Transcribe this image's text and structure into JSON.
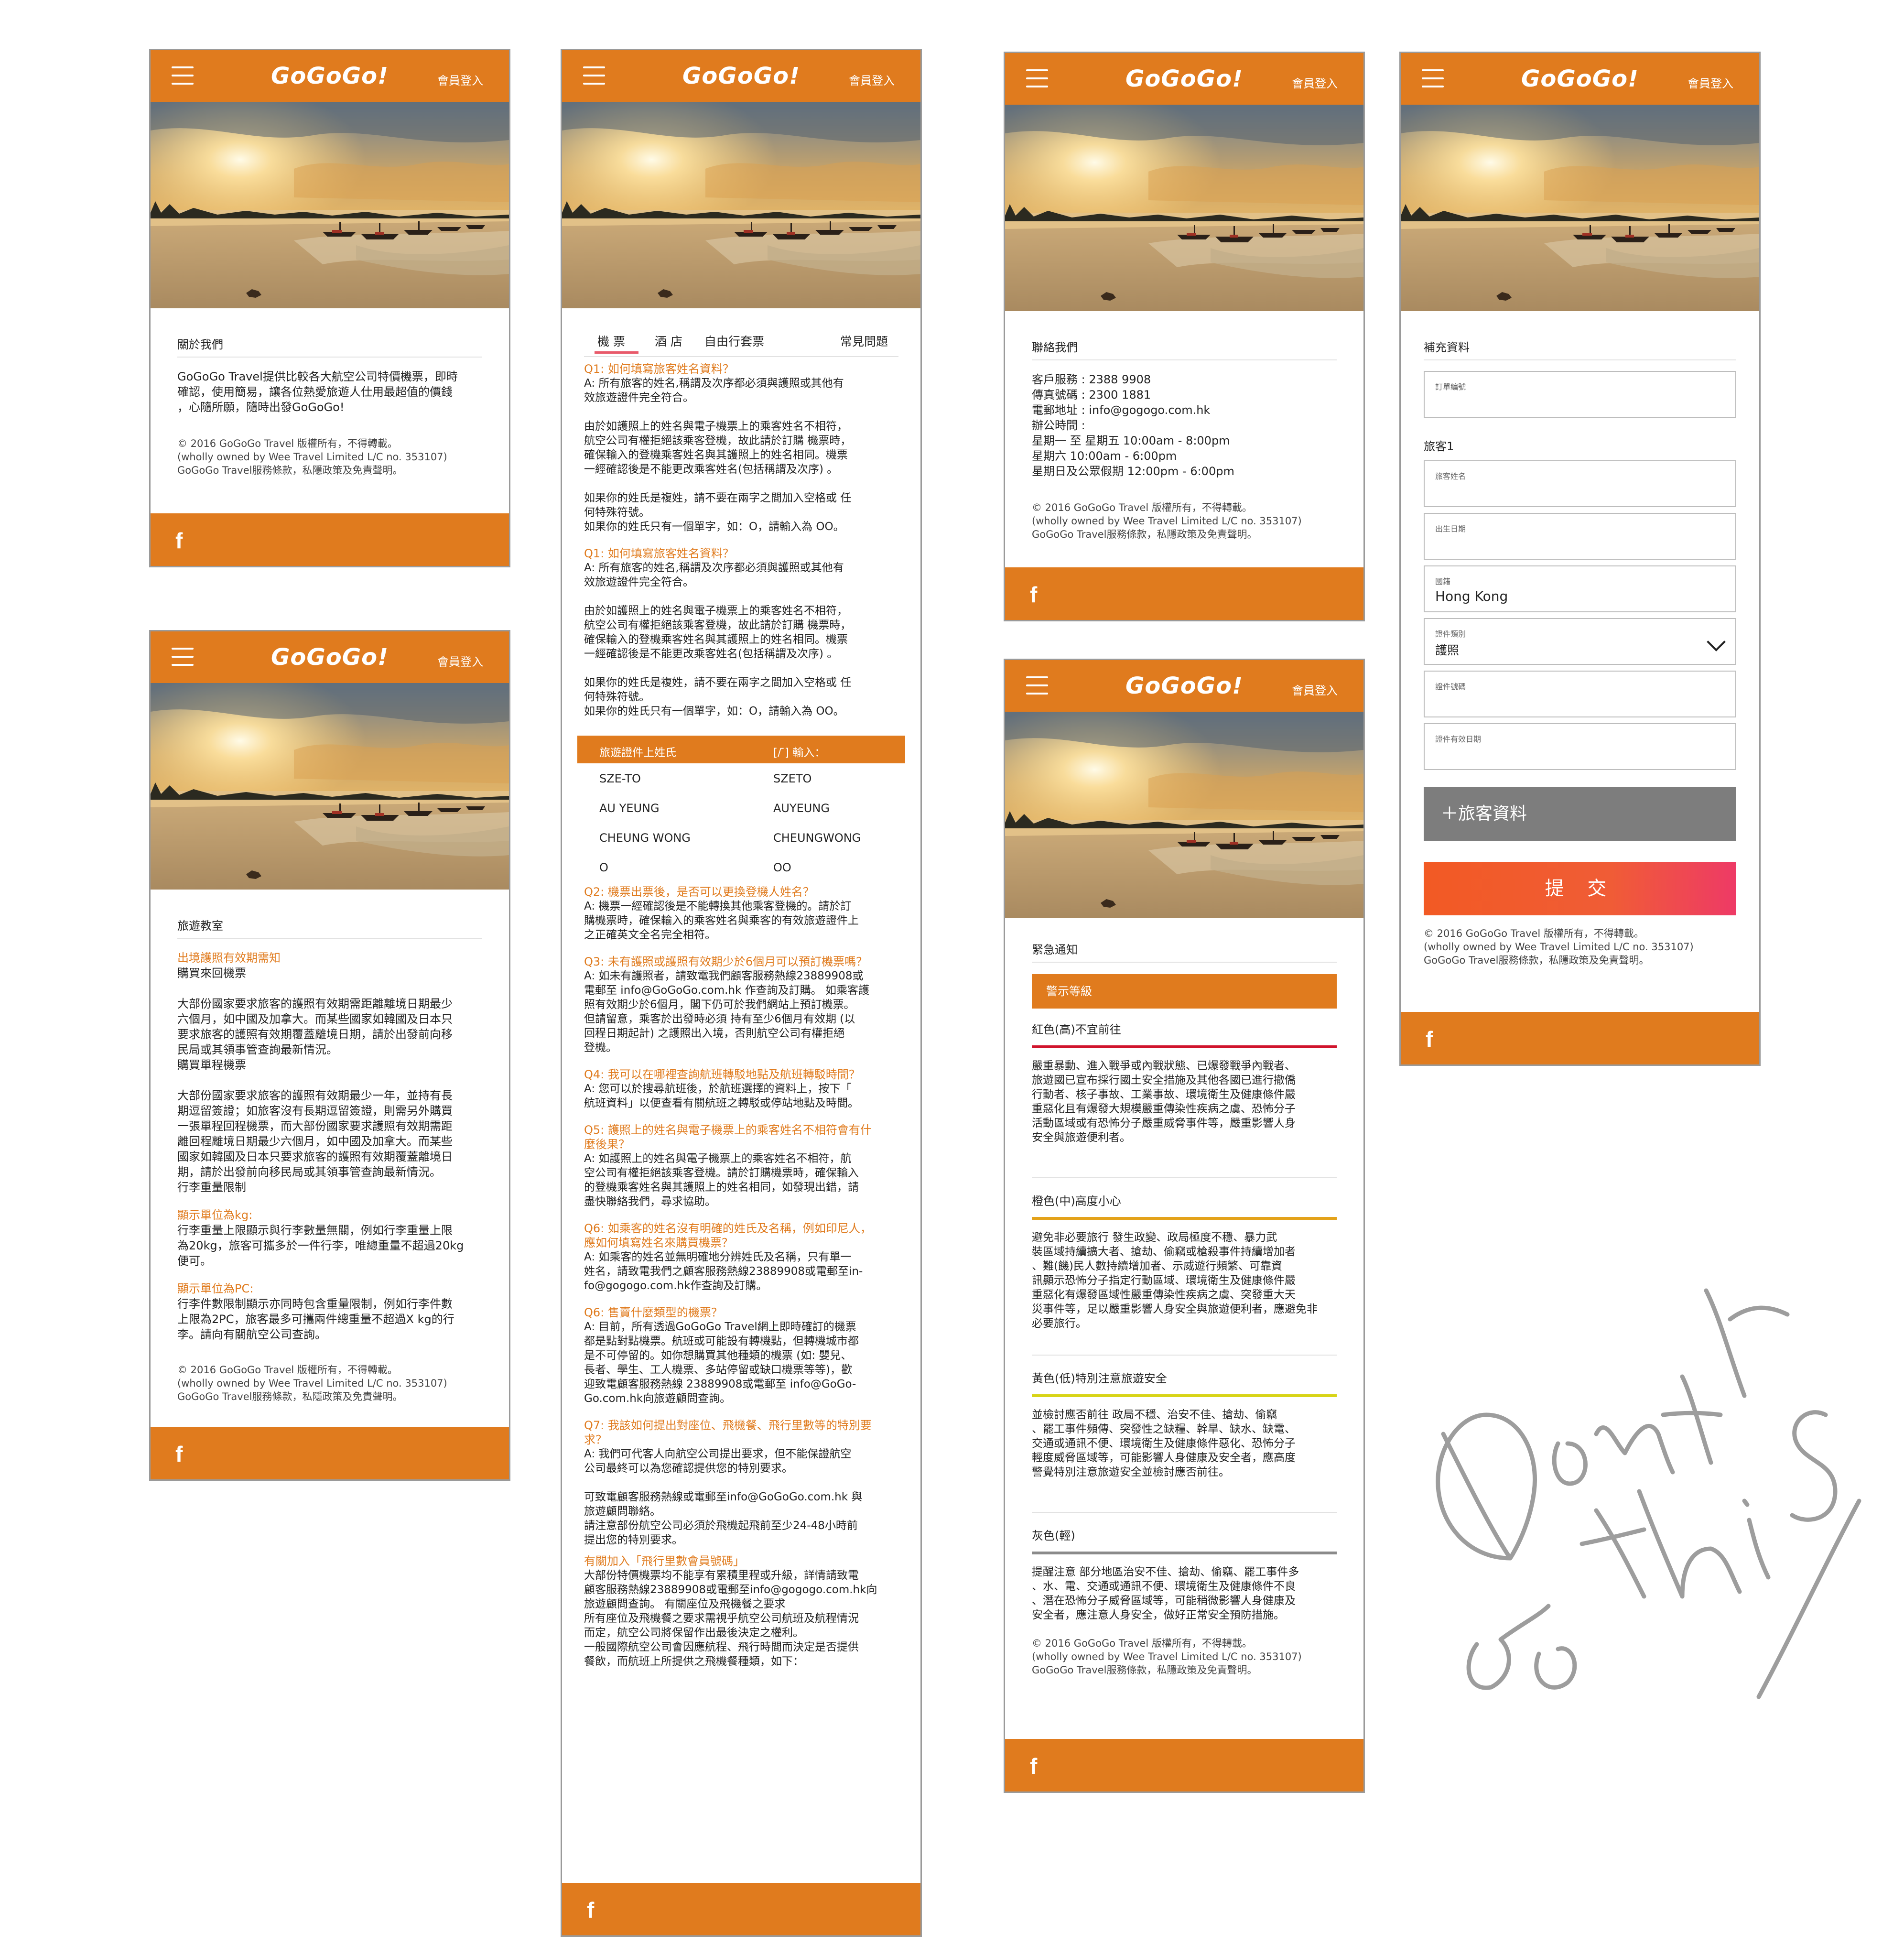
{
  "brand": {
    "logo": "GoGoGo!",
    "login": "會員登入",
    "orange": "#e07b1e"
  },
  "copyright": {
    "line1": "© 2016 GoGoGo Travel 版權所有，不得轉載。",
    "line2": "(wholly owned by Wee Travel Limited L/C no. 353107)",
    "line3": "GoGoGo Travel服務條款，私隱政策及免責聲明。"
  },
  "about": {
    "title": "關於我們",
    "body": "GoGoGo Travel提供比較各大航空公司特價機票，即時\n確認，使用簡易，讓各位熱愛旅遊人仕用最超值的價錢\n，心隨所願，隨時出發GoGoGo!"
  },
  "classroom": {
    "title": "旅遊教室",
    "h1": "出境護照有效期需知",
    "p1": "購買來回機票\n\n大部份國家要求旅客的護照有效期需距離離境日期最少\n六個月，如中國及加拿大。而某些國家如韓國及日本只\n要求旅客的護照有效期覆蓋離境日期，請於出發前向移\n民局或其領事管查詢最新情況。\n購買單程機票\n\n大部份國家要求旅客的護照有效期最少一年，並持有長\n期逗留簽證；如旅客沒有長期逗留簽證，則需另外購買\n一張單程回程機票，而大部份國家要求護照有效期需距\n離回程離境日期最少六個月，如中國及加拿大。而某些\n國家如韓國及日本只要求旅客的護照有效期覆蓋離境日\n期，請於出發前向移民局或其領事管查詢最新情況。\n行李重量限制",
    "h2": "顯示單位為kg:",
    "p2": "行李重量上限顯示與行李數量無關，例如行李重量上限\n為20kg，旅客可攜多於一件行李，唯總重量不超過20kg\n便可。",
    "h3": "顯示單位為PC:",
    "p3": "行李件數限制顯示亦同時包含重量限制，例如行李件數\n上限為2PC，旅客最多可攜兩件總重量不超過X kg的行\n李。請向有關航空公司查詢。"
  },
  "faq": {
    "tabs": [
      "機 票",
      "酒 店",
      "自由行套票",
      "常見問題"
    ],
    "q1": "Q1: 如何填寫旅客姓名資料？",
    "a1": "A: 所有旅客的姓名,稱謂及次序都必須與護照或其他有\n效旅遊證件完全符合。\n\n由於如護照上的姓名與電子機票上的乘客姓名不相符，\n航空公司有權拒絕該乘客登機，故此請於訂購 機票時，\n確保輸入的登機乘客姓名與其護照上的姓名相同。機票\n一經確認後是不能更改乘客姓名(包括稱謂及次序) 。\n\n如果你的姓氏是複姓，請不要在兩字之間加入空格或 任\n何特殊符號。\n如果你的姓氏只有一個單字，如：O，請輸入為 OO。",
    "q1b": "Q1: 如何填寫旅客姓名資料？",
    "a1b": "A: 所有旅客的姓名,稱謂及次序都必須與護照或其他有\n效旅遊證件完全符合。\n\n由於如護照上的姓名與電子機票上的乘客姓名不相符，\n航空公司有權拒絕該乘客登機，故此請於訂購 機票時，\n確保輸入的登機乘客姓名與其護照上的姓名相同。機票\n一經確認後是不能更改乘客姓名(包括稱謂及次序) 。\n\n如果你的姓氏是複姓，請不要在兩字之間加入空格或 任\n何特殊符號。\n如果你的姓氏只有一個單字，如：O，請輸入為 OO。",
    "table": {
      "head": [
        "旅遊證件上姓氏",
        "[/ ̄] 輸入："
      ],
      "rows": [
        [
          "SZE-TO",
          "SZETO"
        ],
        [
          "AU YEUNG",
          "AUYEUNG"
        ],
        [
          "CHEUNG WONG",
          "CHEUNGWONG"
        ],
        [
          "O",
          "OO"
        ]
      ]
    },
    "q2": "Q2: 機票出票後，是否可以更換登機人姓名？",
    "a2": "A: 機票一經確認後是不能轉換其他乘客登機的。請於訂\n購機票時，確保輸入的乘客姓名與乘客的有效旅遊證件上\n之正確英文全名完全相符。",
    "q3": "Q3: 未有護照或護照有效期少於6個月可以預訂機票嗎？",
    "a3": "A: 如未有護照者，請致電我們顧客服務熱線23889908或\n電郵至 info@GoGoGo.com.hk 作查詢及訂購。 如乘客護\n照有效期少於6個月，閣下仍可於我們網站上預訂機票。\n但請留意，乘客於出發時必須 持有至少6個月有效期 (以\n回程日期起計) 之護照出入境，否則航空公司有權拒絕\n登機。",
    "q4": "Q4: 我可以在哪裡查詢航班轉駁地點及航班轉駁時間？",
    "a4": "A: 您可以於搜尋航班後，於航班選擇的資料上，按下「\n航班資料」以便查看有關航班之轉駁或停站地點及時間。",
    "q5": "Q5: 護照上的姓名與電子機票上的乘客姓名不相符會有什\n麼後果？",
    "a5": "A: 如護照上的姓名與電子機票上的乘客姓名不相符，航\n空公司有權拒絕該乘客登機。請於訂購機票時，確保輸入\n的登機乘客姓名與其護照上的姓名相同，如發現出錯，請\n盡快聯絡我們，尋求協助。",
    "q6": "Q6: 如乘客的姓名沒有明確的姓氏及名稱，例如印尼人，\n應如何填寫姓名來購買機票？",
    "a6": "A: 如乘客的姓名並無明確地分辨姓氏及名稱，只有單一\n姓名，請致電我們之顧客服務熱線23889908或電郵至in-\nfo@gogogo.com.hk作查詢及訂購。",
    "q7": "Q6: 售賣什麼類型的機票？",
    "a7": "A: 目前，所有透過GoGoGo Travel網上即時確訂的機票\n都是點對點機票。航班或可能設有轉機點，但轉機城市都\n是不可停留的。如你想購買其他種類的機票 (如: 嬰兒、\n長者、學生、工人機票、多站停留或缺口機票等等)，歡\n迎致電顧客服務熱線 23889908或電郵至 info@GoGo-\nGo.com.hk向旅遊顧問查詢。",
    "q8": "Q7: 我該如何提出對座位、飛機餐、飛行里數等的特別要\n求？",
    "a8": "A: 我們可代客人向航空公司提出要求，但不能保證航空\n公司最終可以為您確認提供您的特別要求。\n\n可致電顧客服務熱線或電郵至info@GoGoGo.com.hk 與\n旅遊顧問聯絡。\n請注意部份航空公司必須於飛機起飛前至少24-48小時前\n提出您的特別要求。",
    "q9": "有關加入「飛行里數會員號碼」",
    "a9": "大部份特價機票均不能享有累積里程或升級，詳情請致電\n顧客服務熱線23889908或電郵至info@gogogo.com.hk向\n旅遊顧問查詢。 有關座位及飛機餐之要求\n所有座位及飛機餐之要求需視乎航空公司航班及航程情況\n而定，航空公司將保留作出最後決定之權利。\n一般國際航空公司會因應航程、飛行時間而決定是否提供\n餐飲，而航班上所提供之飛機餐種類，如下："
  },
  "contact": {
    "title": "聯絡我們",
    "body": "客戶服務  : 2388 9908\n傳真號碼  : 2300 1881\n電郵地址  : info@gogogo.com.hk\n辦公時間  :\n星期一 至 星期五     10:00am - 8:00pm\n星期六                   10:00am - 6:00pm\n星期日及公眾假期   12:00pm - 6:00pm"
  },
  "alerts": {
    "title": "緊急通知",
    "header": "警示等級",
    "levels": [
      {
        "title": "紅色(高)不宜前往",
        "color": "#d0142c",
        "body": "嚴重暴動、進入戰爭或內戰狀態、已爆發戰爭內戰者、\n旅遊國已宣布採行國土安全措施及其他各國已進行撤僑\n行動者、核子事故、工業事故、環境衛生及健康條件嚴\n重惡化且有爆發大規模嚴重傳染性疾病之虞、恐怖分子\n活動區域或有恐怖分子嚴重威脅事件等，嚴重影響人身\n安全與旅遊便利者。"
      },
      {
        "title": "橙色(中)高度小心",
        "color": "#e3a21a",
        "body": "避免非必要旅行     發生政變、政局極度不穩、暴力武\n裝區域持續擴大者、搶劫、偷竊或槍殺事件持續增加者\n、難(饑)民人數持續增加者、示威遊行頻繁、可靠資\n訊顯示恐怖分子指定行動區域、環境衛生及健康條件嚴\n重惡化有爆發區域性嚴重傳染性疾病之虞、突發重大天\n災事件等，足以嚴重影響人身安全與旅遊便利者，應避免非\n必要旅行。"
      },
      {
        "title": "黃色(低)特別注意旅遊安全",
        "color": "#d8d416",
        "body": "並檢討應否前往     政局不穩、治安不佳、搶劫、偷竊\n、罷工事件頻傳、突發性之缺糧、幹旱、缺水、缺電、\n交通或通訊不便、環境衛生及健康條件惡化、恐怖分子\n輕度威脅區域等，可能影響人身健康及安全者，應高度\n警覺特別注意旅遊安全並檢討應否前往。"
      },
      {
        "title": "灰色(輕)",
        "color": "#8a8a8a",
        "body": "提醒注意 部分地區治安不佳、搶劫、偷竊、罷工事件多\n、水、電、交通或通訊不便、環境衛生及健康條件不良\n、潛在恐怖分子威脅區域等，可能稍微影響人身健康及\n安全者，應注意人身安全，做好正常安全預防措施。"
      }
    ]
  },
  "form": {
    "title": "補充資料",
    "order_label": "訂單編號",
    "traveler": "旅客1",
    "fields": [
      {
        "label": "旅客姓名",
        "value": ""
      },
      {
        "label": "出生日期",
        "value": ""
      },
      {
        "label": "國籍",
        "value": "Hong Kong"
      },
      {
        "label": "證件類別",
        "value": "護照"
      },
      {
        "label": "證件號碼",
        "value": ""
      },
      {
        "label": "證件有效日期",
        "value": ""
      }
    ],
    "add": "＋旅客資料",
    "submit": "提 交"
  },
  "scribble_text": "Don't do this"
}
